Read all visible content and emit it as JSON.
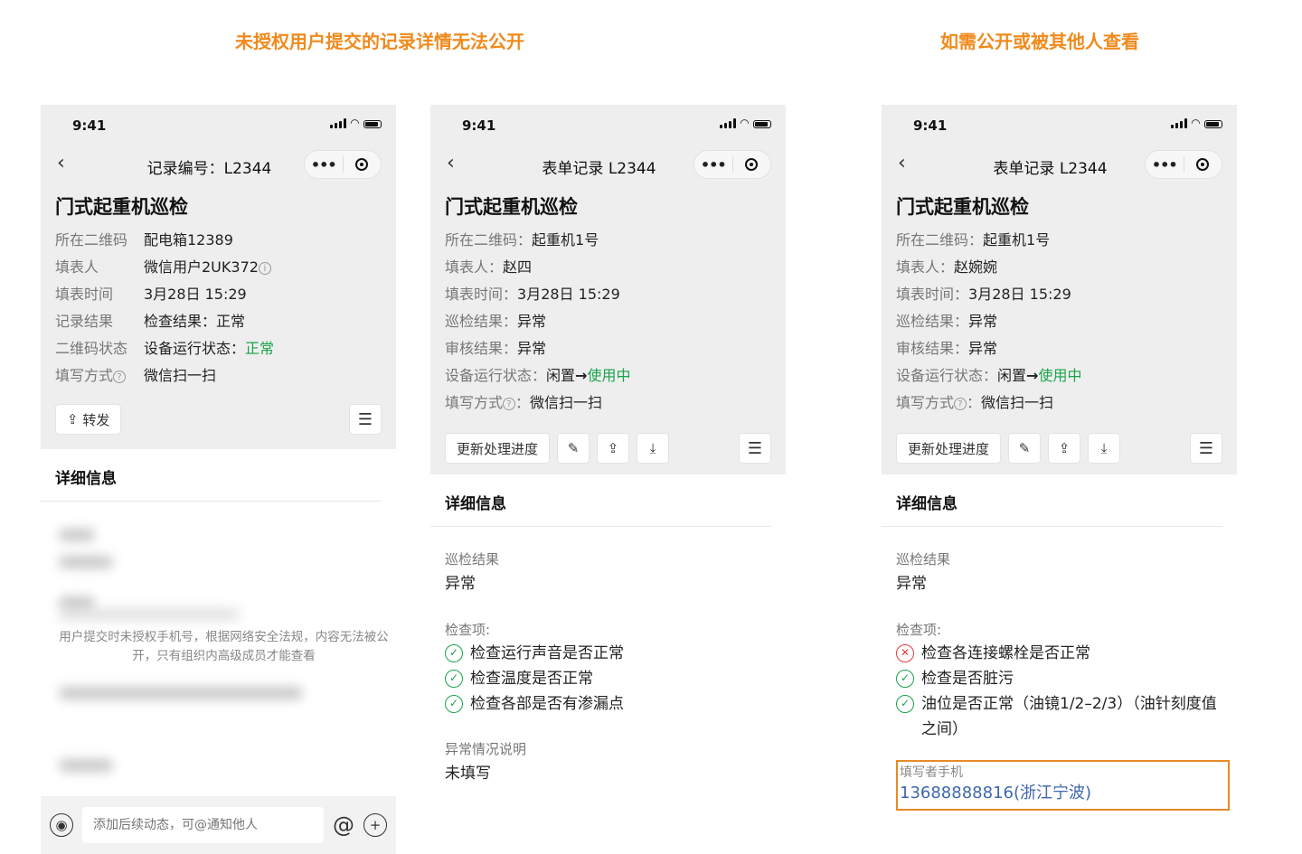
{
  "captions": {
    "left": "未授权用户提交的记录详情无法公开",
    "right": "如需公开或被其他人查看"
  },
  "common": {
    "time": "9:41",
    "back_icon": "‹",
    "more_icon": "•••",
    "form_title": "门式起重机巡检",
    "detail_heading": "详细信息",
    "menu_icon": "☰"
  },
  "phone1": {
    "nav_title": "记录编号：L2344",
    "fields": [
      {
        "label": "所在二维码",
        "value": "配电箱12389"
      },
      {
        "label": "填表人",
        "value": "微信用户2UK372"
      },
      {
        "label": "填表时间",
        "value": "3月28日 15:29"
      },
      {
        "label": "记录结果",
        "value": "检查结果：正常"
      },
      {
        "label": "二维码状态",
        "value_prefix": "设备运行状态：",
        "value_status": "正常"
      },
      {
        "label": "填写方式",
        "value": "微信扫一扫"
      }
    ],
    "info_icon": "i",
    "question_icon": "?",
    "forward_button": "转发",
    "notice": "用户提交时未授权手机号，根据网络安全法规，内容无法被公开，只有组织内高级成员才能查看",
    "comment_placeholder": "添加后续动态，可@通知他人",
    "at_icon": "@",
    "voice_icon": "◉",
    "plus_icon": "+"
  },
  "phone2": {
    "nav_title": "表单记录 L2344",
    "fields": [
      {
        "label": "所在二维码：",
        "value": "起重机1号"
      },
      {
        "label": "填表人：",
        "value": "赵四"
      },
      {
        "label": "填表时间：",
        "value": "3月28日 15:29"
      },
      {
        "label": "巡检结果：",
        "value": "异常"
      },
      {
        "label": "审核结果：",
        "value": "异常"
      },
      {
        "label": "设备运行状态：",
        "value_from": "闲置",
        "arrow": "→",
        "value_to": "使用中"
      },
      {
        "label": "填写方式",
        "label_suffix": "：",
        "value": "微信扫一扫"
      }
    ],
    "update_button": "更新处理进度",
    "edit_icon": "✎",
    "share_icon": "⇪",
    "download_icon": "⤓",
    "detail": {
      "result_label": "巡检结果",
      "result_value": "异常",
      "checks_label": "检查项:",
      "checks": [
        {
          "mark": "✓",
          "text": "检查运行声音是否正常"
        },
        {
          "mark": "✓",
          "text": "检查温度是否正常"
        },
        {
          "mark": "✓",
          "text": "检查各部是否有渗漏点"
        }
      ],
      "abnormal_label": "异常情况说明",
      "abnormal_value": "未填写"
    }
  },
  "phone3": {
    "nav_title": "表单记录 L2344",
    "fields": [
      {
        "label": "所在二维码：",
        "value": "起重机1号"
      },
      {
        "label": "填表人：",
        "value": "赵婉婉"
      },
      {
        "label": "填表时间：",
        "value": "3月28日 15:29"
      },
      {
        "label": "巡检结果：",
        "value": "异常"
      },
      {
        "label": "审核结果：",
        "value": "异常"
      },
      {
        "label": "设备运行状态：",
        "value_from": "闲置",
        "arrow": "→",
        "value_to": "使用中"
      },
      {
        "label": "填写方式",
        "label_suffix": "：",
        "value": "微信扫一扫"
      }
    ],
    "update_button": "更新处理进度",
    "detail": {
      "result_label": "巡检结果",
      "result_value": "异常",
      "checks_label": "检查项:",
      "checks": [
        {
          "mark": "✕",
          "text": "检查各连接螺栓是否正常"
        },
        {
          "mark": "✓",
          "text": "检查是否脏污"
        },
        {
          "mark": "✓",
          "text": "油位是否正常（油镜1/2–2/3）（油针刻度值之间）"
        }
      ],
      "phone_label": "填写者手机",
      "phone_value": "13688888816(浙江宁波)"
    }
  },
  "colors": {
    "caption": "#f08a1c",
    "link": "#3f67ad",
    "status_green": "#1aa34a",
    "error_red": "#e23c3c",
    "highlight_border": "#e78a26"
  }
}
